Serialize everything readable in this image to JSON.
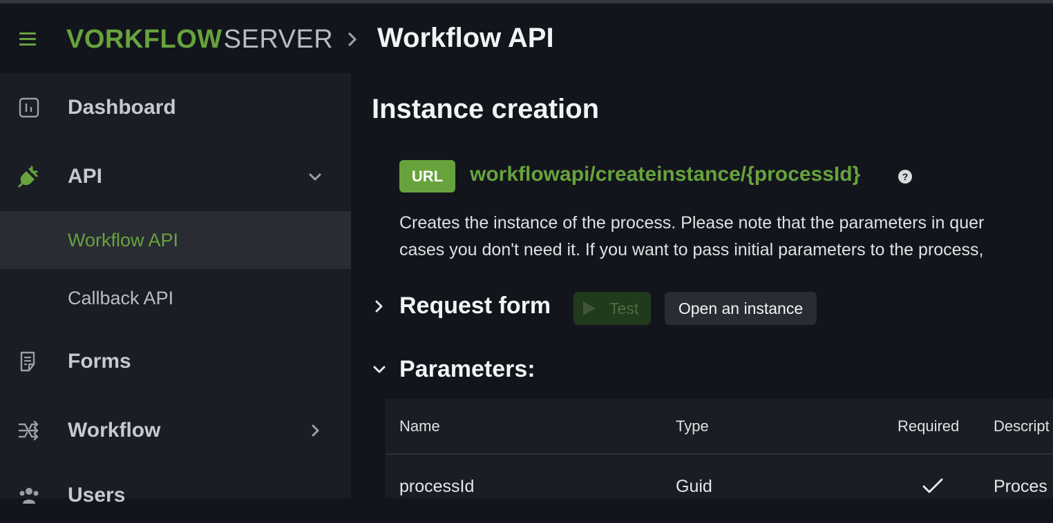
{
  "header": {
    "logo": {
      "first_letter": "V",
      "rest_bold": "ORKFLOW",
      "light": "SERVER"
    },
    "title": "Workflow API"
  },
  "sidebar": {
    "items": [
      {
        "label": "Dashboard",
        "icon": "chart-box-icon"
      },
      {
        "label": "API",
        "icon": "plug-icon"
      },
      {
        "label": "Workflow API",
        "active": true
      },
      {
        "label": "Callback API"
      },
      {
        "label": "Forms",
        "icon": "form-document-icon"
      },
      {
        "label": "Workflow",
        "icon": "workflow-arrows-icon"
      },
      {
        "label": "Users",
        "icon": "users-icon"
      }
    ]
  },
  "main": {
    "section_title": "Instance creation",
    "url_badge": "URL",
    "url_path": "workflowapi/createinstance/{processId}",
    "help": "?",
    "description_line1": "Creates the instance of the process. Please note that the parameters in quer",
    "description_line2": "cases you don't need it. If you want to pass initial parameters to the process,",
    "request_form": {
      "title": "Request form",
      "test_label": "Test",
      "open_label": "Open an instance"
    },
    "parameters": {
      "title": "Parameters:",
      "columns": [
        "Name",
        "Type",
        "Required",
        "Descript"
      ],
      "rows": [
        {
          "name": "processId",
          "type": "Guid",
          "required": true,
          "description": "Proces"
        }
      ]
    }
  },
  "colors": {
    "accent": "#67a33d",
    "background": "#13151c",
    "sidebar": "#1b1d24",
    "active_item": "#2a2c33"
  }
}
